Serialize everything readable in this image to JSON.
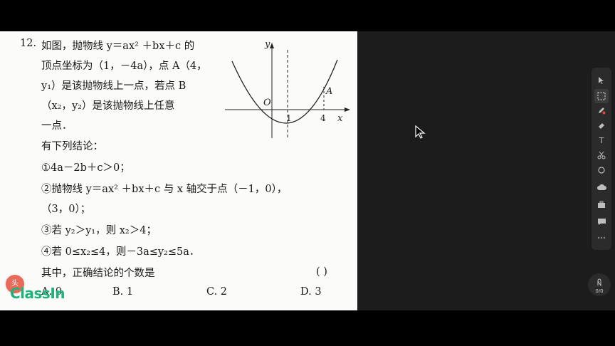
{
  "question": {
    "number": "12.",
    "lines": [
      "如图，抛物线 y＝ax² ＋bx＋c 的",
      "顶点坐标为（1，－4a），点 A（4，",
      "y₁）是该抛物线上一点，若点 B",
      "（x₂，y₂）是该抛物线上任意",
      "一点．",
      "有下列结论：",
      "①4a－2b＋c＞0；",
      "②抛物线 y＝ax² ＋bx＋c 与 x 轴交于点（－1，0），",
      "（3，0）；",
      "③若 y₂＞y₁，则 x₂＞4；",
      "④若 0≤x₂≤4，则－3a≤y₂≤5a．",
      "其中，正确结论的个数是"
    ],
    "answer_blank": "(      )",
    "options": [
      "A. 0",
      "B. 1",
      "C. 2",
      "D. 3"
    ]
  },
  "graph": {
    "y_axis": "y",
    "x_axis": "x",
    "origin": "O",
    "tick_1": "1",
    "tick_4": "4",
    "point_a": "A"
  },
  "toolbar": {
    "tools": [
      "pointer",
      "select",
      "pen",
      "eraser",
      "text",
      "scissors",
      "shapes",
      "cloud",
      "toolbox",
      "chat"
    ],
    "text_tool_label": "T"
  },
  "counter": {
    "value": "0/0"
  },
  "brand": {
    "name": "ClassIn"
  },
  "avatar": {
    "label": "头"
  },
  "colors": {
    "brand": "#20b27a",
    "board": "#1c1c1c",
    "toolbar": "#2b2b2b"
  }
}
